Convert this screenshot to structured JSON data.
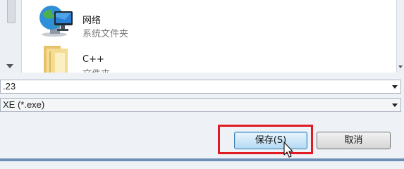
{
  "file_list": {
    "items": [
      {
        "name": "网络",
        "type": "系统文件夹",
        "icon": "network-globe-icon"
      },
      {
        "name": "C++",
        "type": "文件夹",
        "icon": "folder-icon"
      }
    ]
  },
  "save_form": {
    "filename_value": ".23",
    "filetype_value": "XE (*.exe)"
  },
  "buttons": {
    "save_label": "保存(S)",
    "cancel_label": "取消"
  },
  "colors": {
    "highlight": "#e11b22",
    "save_button_border": "#3c7fb1"
  }
}
